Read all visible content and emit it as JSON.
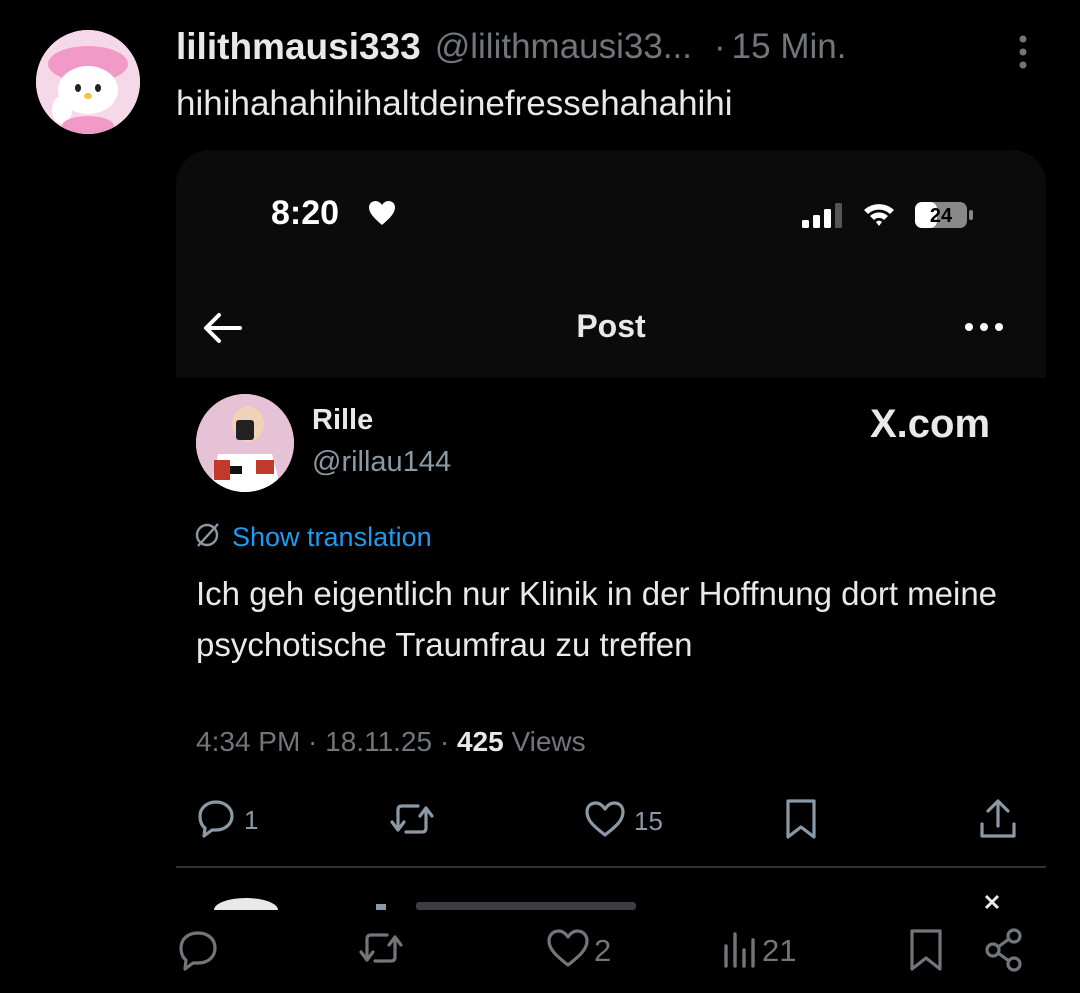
{
  "post": {
    "display_name": "lilithmausi333",
    "handle": "@lilithmausi33...",
    "separator": "·",
    "time": "15 Min.",
    "text": "hihihahahihihaltdeinefressehahahihi"
  },
  "screenshot": {
    "status_time": "8:20",
    "battery": "24",
    "nav_title": "Post",
    "quoted": {
      "name": "Rille",
      "handle": "@rillau144",
      "watermark": "X.com",
      "translation_label": "Show translation",
      "text": "Ich geh eigentlich nur Klinik in der Hoffnung dort meine psychotische Traumfrau zu treffen",
      "meta_time": "4:34 PM · 18.11.25 · ",
      "views_count": "425",
      "views_label": " Views",
      "replies": "1",
      "likes": "15"
    }
  },
  "actions": {
    "likes": "2",
    "views": "21"
  },
  "icons": [
    "more-vertical-icon",
    "heart-icon",
    "signal-icon",
    "wifi-icon",
    "battery-icon",
    "back-arrow-icon",
    "more-horizontal-icon",
    "globe-icon",
    "reply-icon",
    "retweet-icon",
    "like-icon",
    "bookmark-icon",
    "share-icon",
    "views-icon"
  ]
}
